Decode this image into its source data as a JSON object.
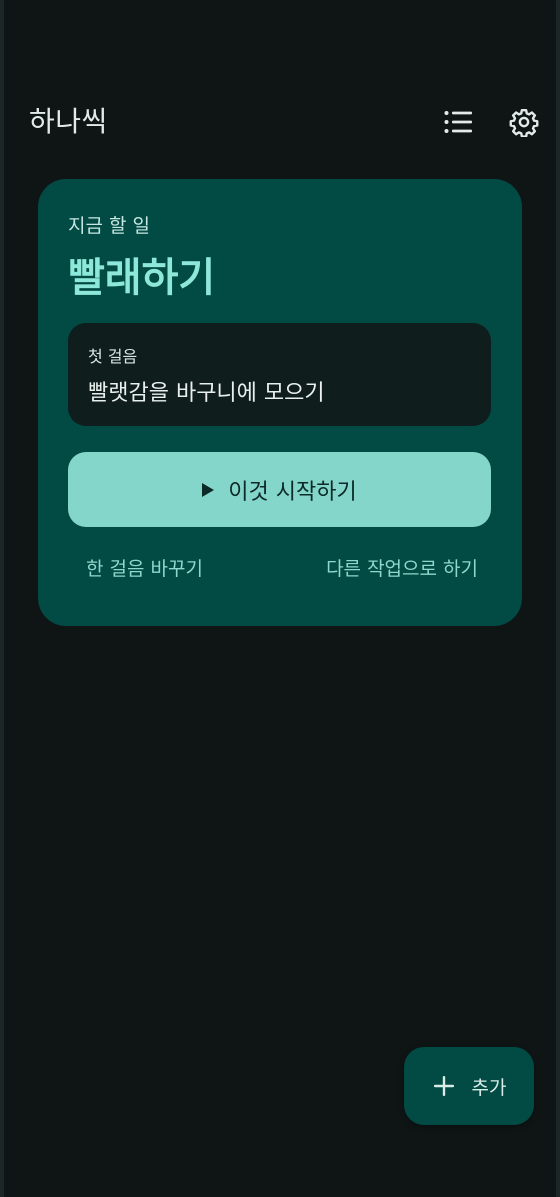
{
  "header": {
    "app_title": "하나씩",
    "list_icon": "list-icon",
    "settings_icon": "gear-icon"
  },
  "task_card": {
    "label": "지금 할 일",
    "title": "빨래하기",
    "step": {
      "label": "첫 걸음",
      "text": "빨랫감을 바구니에 모으기"
    },
    "start_button": {
      "icon": "play-icon",
      "label": "이것 시작하기"
    },
    "change_step_link": "한 걸음 바꾸기",
    "other_task_link": "다른 작업으로 하기"
  },
  "fab": {
    "icon": "plus-icon",
    "label": "추가"
  },
  "colors": {
    "background": "#0f1515",
    "card": "#024a44",
    "accent_title": "#8ee8d9",
    "button": "#85d6ca"
  }
}
